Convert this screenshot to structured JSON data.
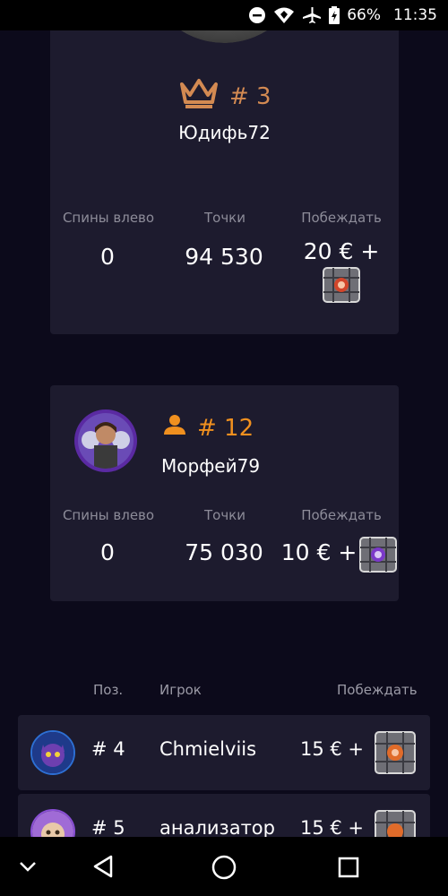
{
  "status_bar": {
    "battery": "66%",
    "time": "11:35"
  },
  "stats_labels": {
    "spins_left": "Спины влево",
    "points": "Точки",
    "win": "Побеждать"
  },
  "top_card": {
    "rank": "# 3",
    "name": "Юдифь72",
    "spins_left": "0",
    "points": "94 530",
    "win": "20 € +"
  },
  "my_card": {
    "rank": "# 12",
    "name": "Морфей79",
    "spins_left": "0",
    "points": "75 030",
    "win": "10 € +"
  },
  "list": {
    "headers": {
      "pos": "Поз.",
      "player": "Игрок",
      "win": "Побеждать"
    },
    "rows": [
      {
        "pos": "# 4",
        "name": "Chmielviis",
        "win": "15 € +"
      },
      {
        "pos": "# 5",
        "name": "анализатор",
        "win": "15 € +"
      }
    ]
  },
  "colors": {
    "accent_bronze": "#d38a52",
    "accent_orange": "#f0901f",
    "card_bg": "#1d1b2e",
    "page_bg": "#0c0a1b"
  }
}
